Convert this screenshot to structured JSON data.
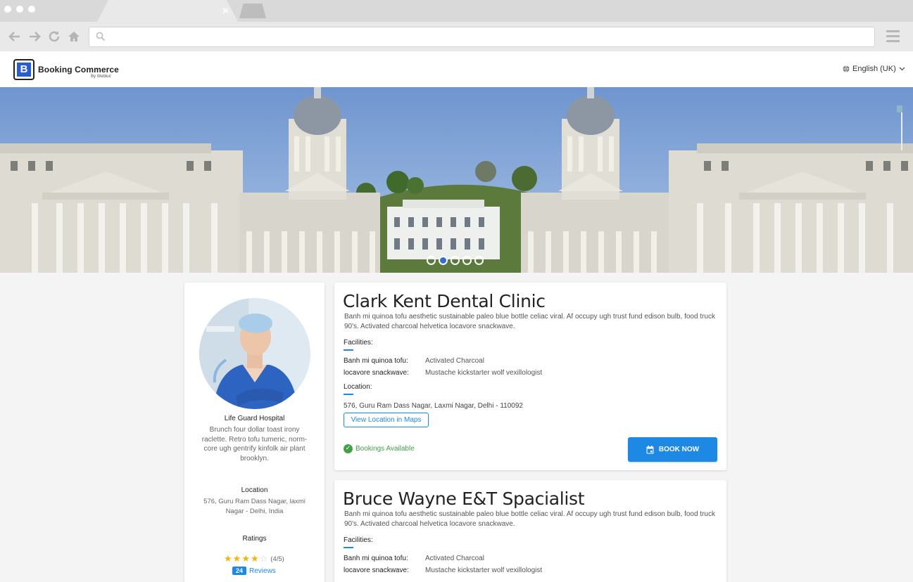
{
  "browser": {
    "tab_close": "×",
    "address_value": "",
    "address_placeholder": ""
  },
  "header": {
    "logo_letter": "B",
    "brand_name": "Booking Commerce",
    "brand_sub": "By Webkul",
    "language": "English (UK)"
  },
  "hero": {
    "slides": 5,
    "active_slide": 2
  },
  "sidebar": {
    "name": "Life Guard Hospital",
    "description": "Brunch four dollar toast irony raclette. Retro tofu tumeric, norm-core ugh gentrify kinfolk air plant brooklyn.",
    "location_label": "Location",
    "location": "576, Guru Ram Dass Nagar, laxmi Nagar - Delhi, India",
    "ratings_label": "Ratings",
    "rating_value": 4,
    "rating_max": 5,
    "rating_text": "(4/5)",
    "reviews_count": "24",
    "reviews_label": "Reviews"
  },
  "listings": [
    {
      "title": "Clark Kent Dental Clinic",
      "description": "Banh mi quinoa tofu aesthetic sustainable paleo blue bottle celiac viral. Af occupy ugh trust fund edison bulb, food truck 90's. Activated charcoal helvetica locavore snackwave.",
      "facilities_label": "Facilities:",
      "facilities": [
        {
          "key": "Banh mi quinoa tofu:",
          "value": "Activated Charcoal"
        },
        {
          "key": "locavore snackwave:",
          "value": "Mustache kickstarter wolf vexillologist"
        }
      ],
      "location_label": "Location:",
      "address": "576, Guru Ram Dass Nagar, Laxmi Nagar, Delhi - 110092",
      "maps_label": "View Location in Maps",
      "availability": "Bookings Available",
      "book_label": "BOOK NOW"
    },
    {
      "title": "Bruce Wayne E&T Spacialist",
      "description": "Banh mi quinoa tofu aesthetic sustainable paleo blue bottle celiac viral. Af occupy ugh trust fund edison bulb, food truck 90's. Activated charcoal helvetica locavore snackwave.",
      "facilities_label": "Facilities:",
      "facilities": [
        {
          "key": "Banh mi quinoa tofu:",
          "value": "Activated Charcoal"
        },
        {
          "key": "locavore snackwave:",
          "value": "Mustache kickstarter wolf vexillologist"
        }
      ]
    }
  ],
  "colors": {
    "accent": "#1e88e5",
    "success": "#43a047",
    "star": "#f7b500",
    "logo": "#2a5bd7"
  },
  "icons": {
    "back": "back-arrow-icon",
    "forward": "forward-arrow-icon",
    "reload": "reload-icon",
    "home": "home-icon",
    "search": "search-icon",
    "menu": "hamburger-menu-icon",
    "globe": "globe-icon",
    "calendar": "calendar-icon",
    "check": "check-circle-icon"
  }
}
